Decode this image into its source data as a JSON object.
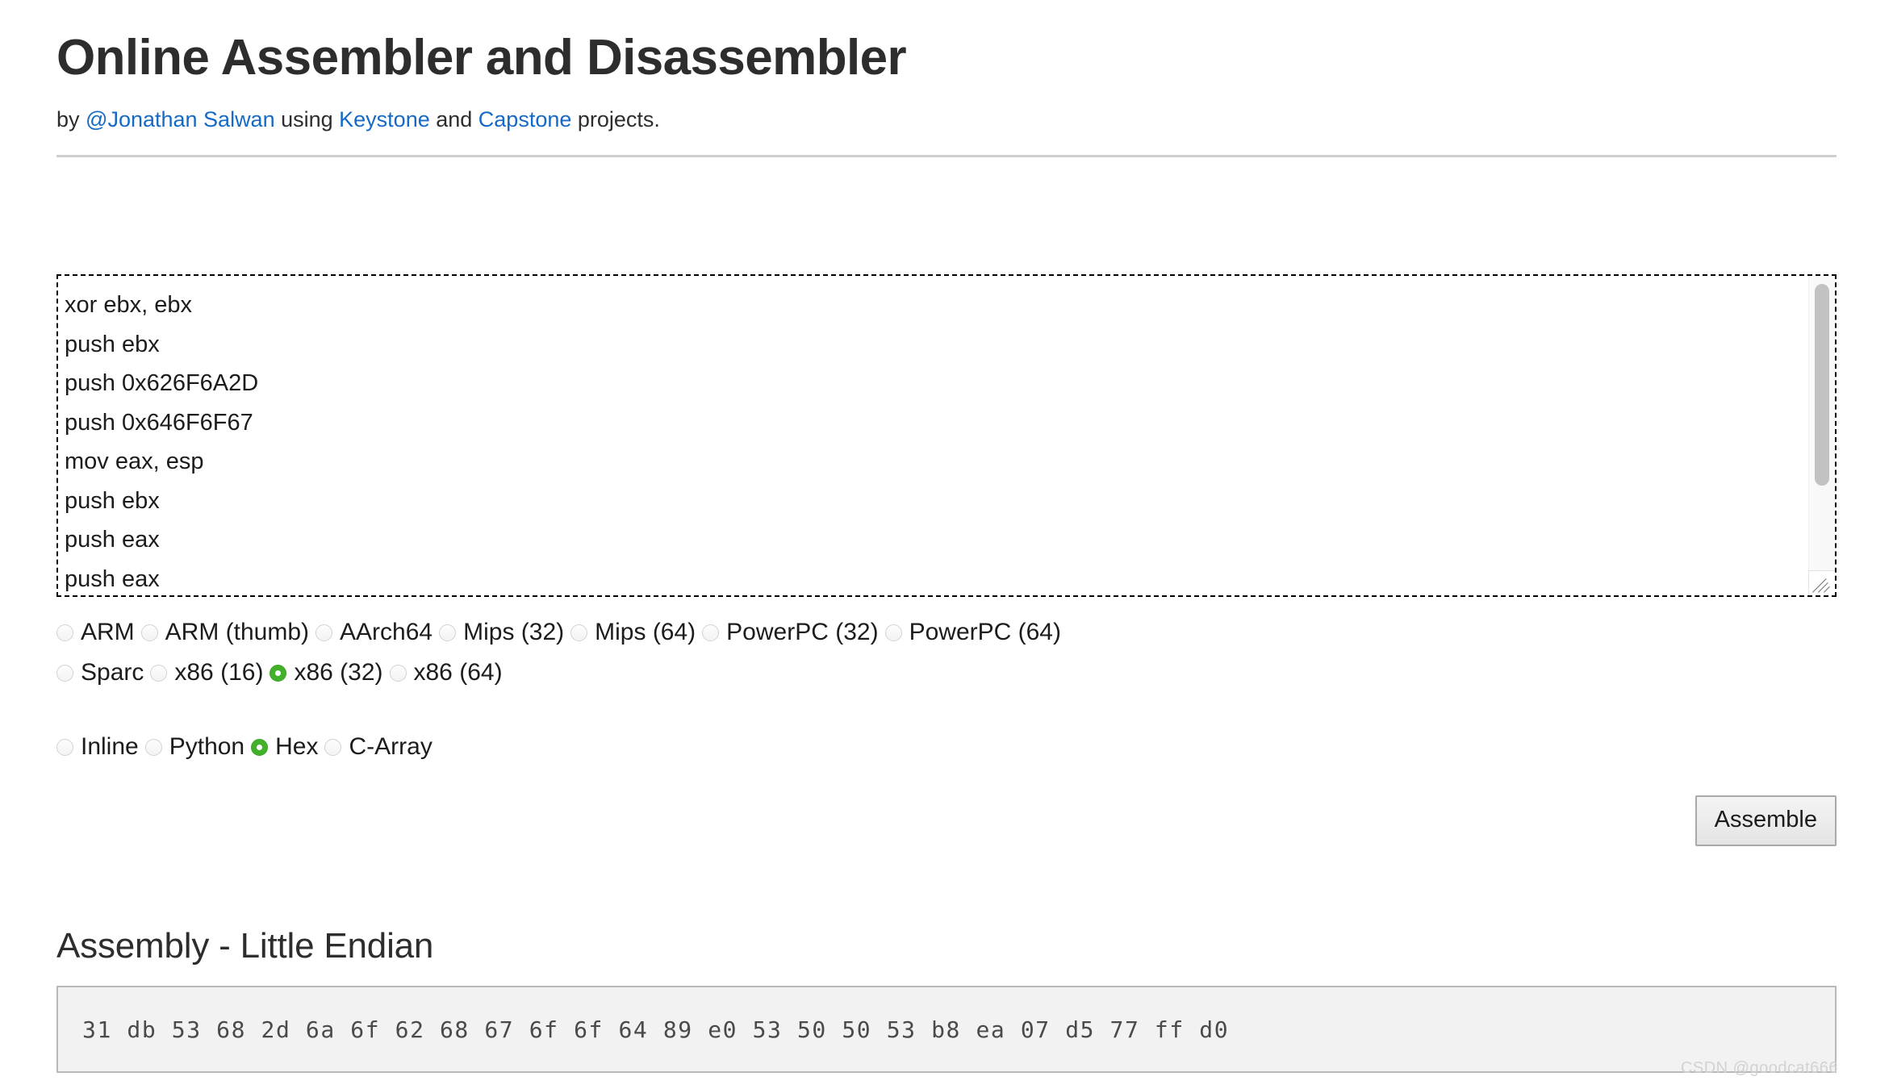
{
  "header": {
    "title": "Online Assembler and Disassembler",
    "byline_prefix": "by ",
    "author_link": "@Jonathan Salwan",
    "byline_mid": " using ",
    "keystone_link": "Keystone",
    "byline_and": " and ",
    "capstone_link": "Capstone",
    "byline_suffix": " projects."
  },
  "editor": {
    "name": "assembly-input",
    "lines": [
      "xor ebx, ebx",
      "push ebx",
      "push 0x626F6A2D",
      "push 0x646F6F67",
      "mov eax, esp",
      "push ebx",
      "push eax",
      "push eax"
    ]
  },
  "architectures": {
    "row1": [
      {
        "label": "ARM",
        "checked": false
      },
      {
        "label": "ARM (thumb)",
        "checked": false
      },
      {
        "label": "AArch64",
        "checked": false
      },
      {
        "label": "Mips (32)",
        "checked": false
      },
      {
        "label": "Mips (64)",
        "checked": false
      },
      {
        "label": "PowerPC (32)",
        "checked": false
      },
      {
        "label": "PowerPC (64)",
        "checked": false
      }
    ],
    "row2": [
      {
        "label": "Sparc",
        "checked": false
      },
      {
        "label": "x86 (16)",
        "checked": false
      },
      {
        "label": "x86 (32)",
        "checked": true
      },
      {
        "label": "x86 (64)",
        "checked": false
      }
    ],
    "selected": "x86 (32)"
  },
  "output_formats": {
    "options": [
      {
        "label": "Inline",
        "checked": false
      },
      {
        "label": "Python",
        "checked": false
      },
      {
        "label": "Hex",
        "checked": true
      },
      {
        "label": "C-Array",
        "checked": false
      }
    ],
    "selected": "Hex"
  },
  "actions": {
    "assemble_label": "Assemble"
  },
  "result": {
    "title": "Assembly - Little Endian",
    "hex": "31 db 53 68 2d 6a 6f 62 68 67 6f 6f 64 89 e0 53 50 50 53 b8 ea 07 d5 77 ff d0"
  },
  "watermark": "CSDN @goodcat666",
  "colors": {
    "link": "#1569c7",
    "radio_checked": "#43b02a",
    "output_bg": "#f2f2f2",
    "rule": "#cfcfcf"
  }
}
